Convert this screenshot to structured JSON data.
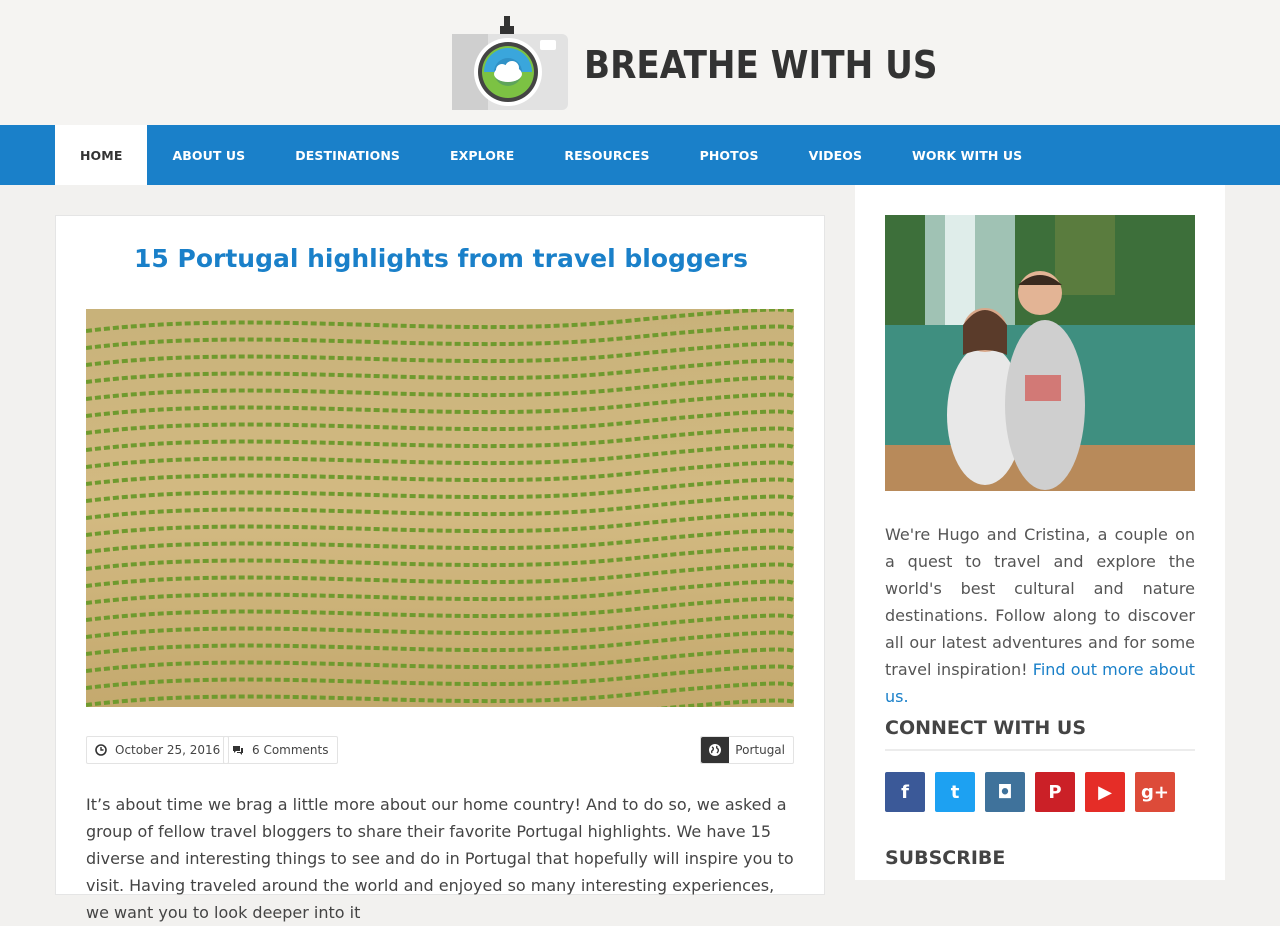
{
  "site": {
    "title": "BREATHE WITH US"
  },
  "nav": {
    "items": [
      {
        "label": "HOME",
        "active": true
      },
      {
        "label": "ABOUT US"
      },
      {
        "label": "DESTINATIONS"
      },
      {
        "label": "EXPLORE"
      },
      {
        "label": "RESOURCES"
      },
      {
        "label": "PHOTOS"
      },
      {
        "label": "VIDEOS"
      },
      {
        "label": "WORK WITH US"
      }
    ]
  },
  "post": {
    "title": "15 Portugal highlights from travel bloggers",
    "image_icon": "vineyard-terraces-photo",
    "date": "October 25, 2016",
    "comments": "6 Comments",
    "category": "Portugal",
    "excerpt": "It’s about time we brag a little more about our home country! And to do so, we asked a group of fellow travel bloggers to share their favorite Portugal highlights. We have 15 diverse and interesting things to see and do in Portugal that hopefully will inspire you to visit. Having traveled around the world and enjoyed so many interesting experiences, we want you to look deeper into it"
  },
  "sidebar": {
    "photo_icon": "couple-at-waterfall-photo",
    "about_text": "We're Hugo and Cristina, a couple on a quest to travel and explore the world's best cultural and nature destinations. Follow along to discover all our latest adventures and for some travel inspiration! ",
    "about_link": "Find out more about us.",
    "connect_title": "CONNECT WITH US",
    "subscribe_title": "SUBSCRIBE",
    "social": [
      {
        "icon": "facebook-icon",
        "glyph": "f",
        "color": "#3b5998"
      },
      {
        "icon": "twitter-icon",
        "glyph": "t",
        "color": "#1da1f2"
      },
      {
        "icon": "instagram-icon",
        "glyph": "◘",
        "color": "#3f729b"
      },
      {
        "icon": "pinterest-icon",
        "glyph": "P",
        "color": "#cb2027"
      },
      {
        "icon": "youtube-icon",
        "glyph": "▶",
        "color": "#e52d27"
      },
      {
        "icon": "google-plus-icon",
        "glyph": "g+",
        "color": "#dd4b39"
      }
    ]
  },
  "colors": {
    "accent": "#1a80c9",
    "background": "#f2f1ef"
  }
}
